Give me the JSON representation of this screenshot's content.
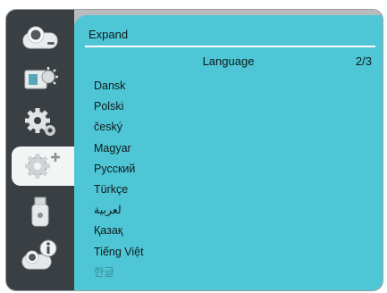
{
  "panel": {
    "title": "Expand",
    "section_header": "Language",
    "page_indicator": "2/3"
  },
  "sidebar": {
    "items": [
      {
        "icon": "projector-icon",
        "active": false
      },
      {
        "icon": "picture-adjust-icon",
        "active": false
      },
      {
        "icon": "settings-gear-icon",
        "active": false
      },
      {
        "icon": "expand-settings-icon",
        "active": true
      },
      {
        "icon": "usb-icon",
        "active": false
      },
      {
        "icon": "information-icon",
        "active": false
      }
    ]
  },
  "languages": [
    {
      "label": "Dansk"
    },
    {
      "label": "Polski"
    },
    {
      "label": "český"
    },
    {
      "label": "Magyar"
    },
    {
      "label": "Русский"
    },
    {
      "label": "Türkçe"
    },
    {
      "label": "لعربية"
    },
    {
      "label": "Қазақ"
    },
    {
      "label": "Tiếng Việt"
    },
    {
      "label": "한글",
      "dim": true
    }
  ],
  "colors": {
    "panel": "#4ec6d6",
    "sidebar": "#3a3f43",
    "active_tab": "#f3f5f5"
  }
}
